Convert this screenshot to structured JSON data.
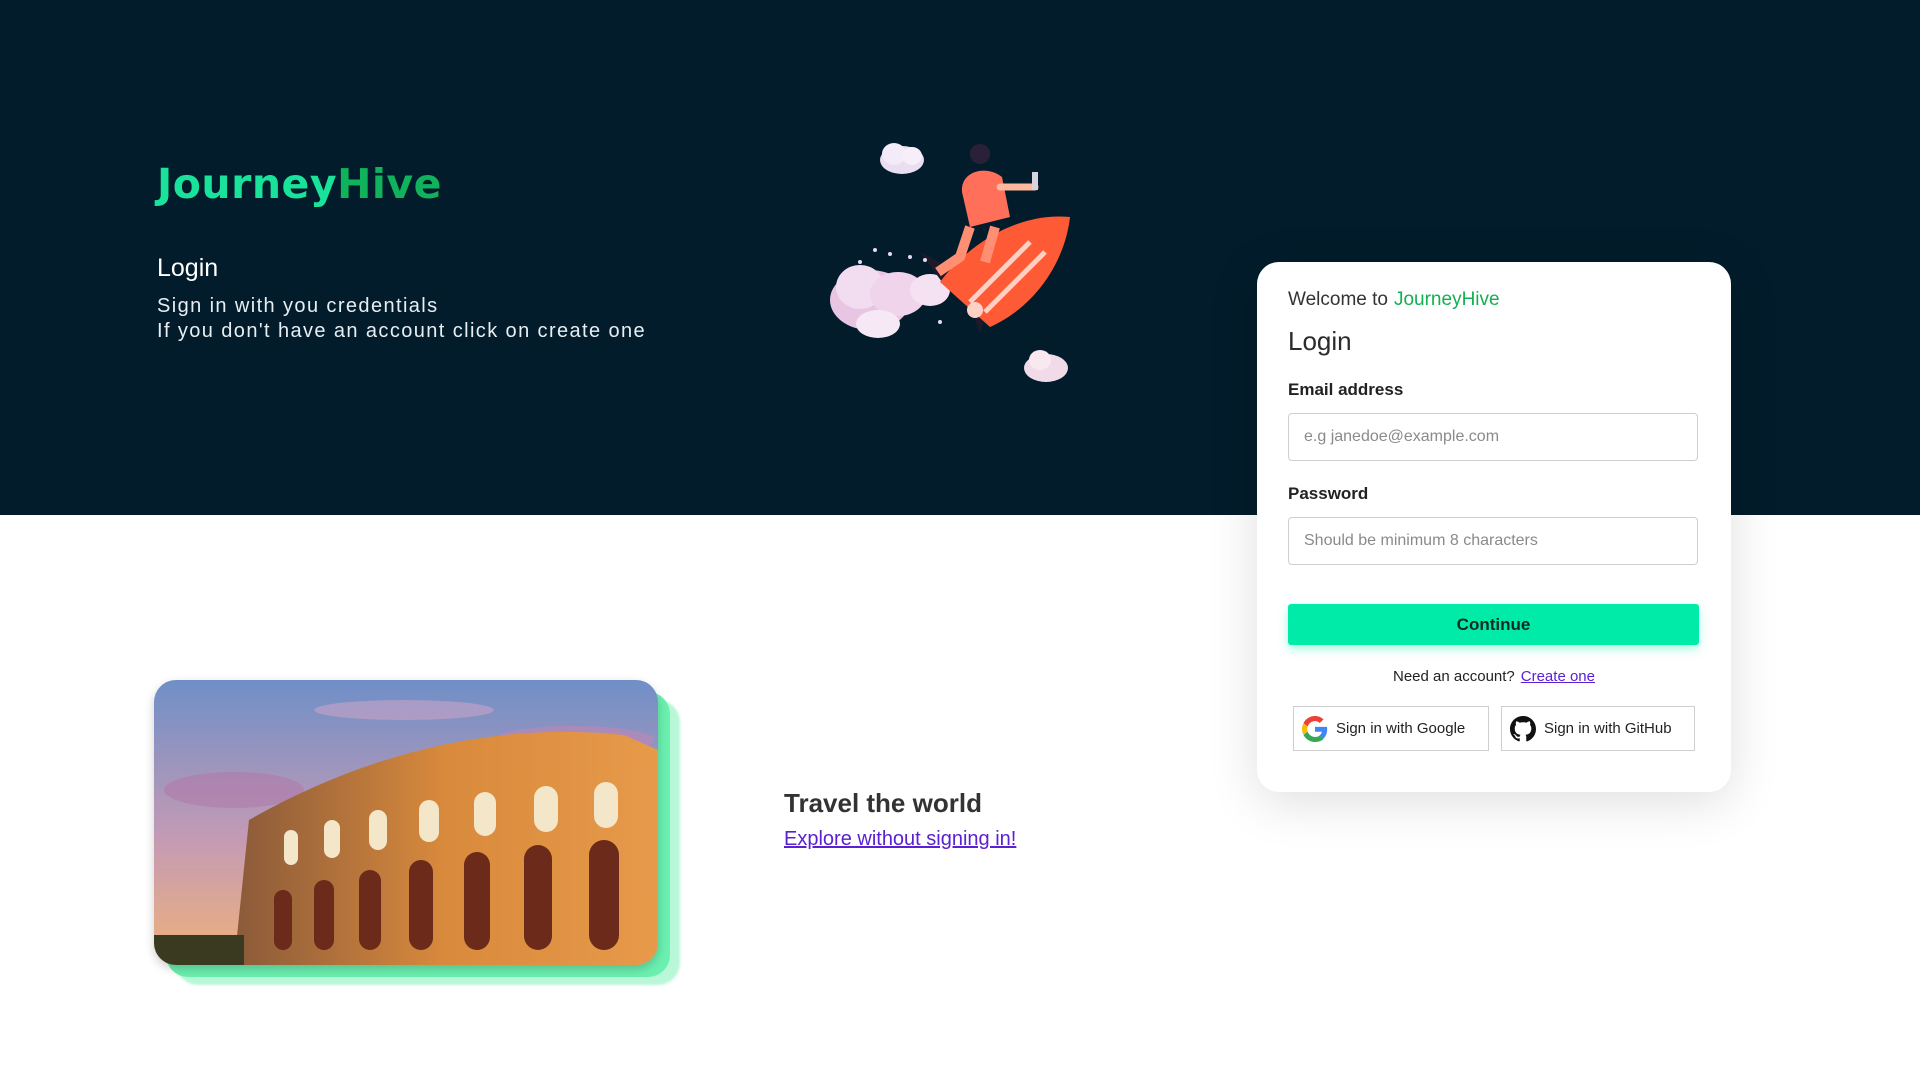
{
  "brand": {
    "part1": "Journey",
    "part2": "Hive"
  },
  "hero": {
    "title": "Login",
    "subtitle_line1": "Sign in with you credentials",
    "subtitle_line2": "If you don't have an account click on create one",
    "illustration": "rocket-rider-illustration"
  },
  "login_card": {
    "welcome": "Welcome to",
    "brand": "JourneyHive",
    "title": "Login",
    "email_label": "Email address",
    "email_placeholder": "e.g janedoe@example.com",
    "email_value": "",
    "password_label": "Password",
    "password_placeholder": "Should be minimum 8 characters",
    "password_value": "",
    "continue_label": "Continue",
    "need_account": "Need an account?",
    "create_link": "Create one",
    "google_label": "Sign in with Google",
    "github_label": "Sign in with GitHub"
  },
  "promo": {
    "title": "Travel the world",
    "link": "Explore without signing in!",
    "image": "colosseum-photo"
  },
  "colors": {
    "hero_bg": "#021c2b",
    "brand_light": "#19e39a",
    "brand_dark": "#10b35c",
    "button": "#00eba8",
    "link": "#5a20d2"
  }
}
